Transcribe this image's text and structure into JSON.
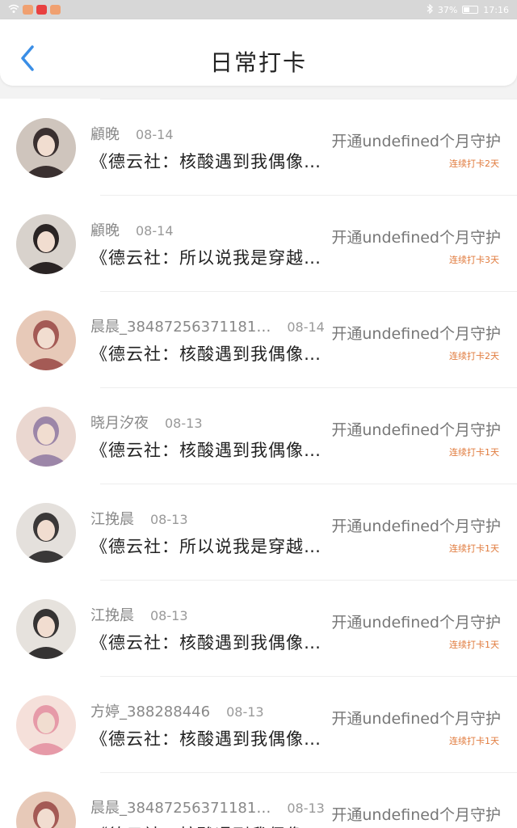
{
  "status_bar": {
    "battery": "37%",
    "time": "17:16",
    "notif_colors": [
      "#f0a070",
      "#e84040",
      "#f0a070"
    ]
  },
  "header": {
    "title": "日常打卡"
  },
  "rows": [
    {
      "name": "顧晚",
      "date": "08-14",
      "message": "《德云社：核酸遇到我偶像…",
      "guard": "开通undefined个月守护",
      "streak": "连续打卡2天",
      "avatar_colors": [
        "#3a3030",
        "#cfc5bd"
      ]
    },
    {
      "name": "顧晚",
      "date": "08-14",
      "message": "《德云社：所以说我是穿越…",
      "guard": "开通undefined个月守护",
      "streak": "连续打卡3天",
      "avatar_colors": [
        "#2a2424",
        "#d8d2cc"
      ]
    },
    {
      "name": "晨晨_38487256371181…",
      "date": "08-14",
      "message": "《德云社：核酸遇到我偶像…",
      "guard": "开通undefined个月守护",
      "streak": "连续打卡2天",
      "avatar_colors": [
        "#a45a55",
        "#e7c9b8"
      ]
    },
    {
      "name": "晓月汐夜",
      "date": "08-13",
      "message": "《德云社：核酸遇到我偶像…",
      "guard": "开通undefined个月守护",
      "streak": "连续打卡1天",
      "avatar_colors": [
        "#9c86a8",
        "#ead7d0"
      ]
    },
    {
      "name": "江挽晨",
      "date": "08-13",
      "message": "《德云社：所以说我是穿越…",
      "guard": "开通undefined个月守护",
      "streak": "连续打卡1天",
      "avatar_colors": [
        "#3a3838",
        "#e4e0dc"
      ]
    },
    {
      "name": "江挽晨",
      "date": "08-13",
      "message": "《德云社：核酸遇到我偶像…",
      "guard": "开通undefined个月守护",
      "streak": "连续打卡1天",
      "avatar_colors": [
        "#353333",
        "#e6e2dd"
      ]
    },
    {
      "name": "方婷_388288446",
      "date": "08-13",
      "message": "《德云社：核酸遇到我偶像…",
      "guard": "开通undefined个月守护",
      "streak": "连续打卡1天",
      "avatar_colors": [
        "#e69aa8",
        "#f5e0da"
      ]
    },
    {
      "name": "晨晨_38487256371181…",
      "date": "08-13",
      "message": "《德云社：核酸遇到我偶像…",
      "guard": "开通undefined个月守护",
      "streak": "",
      "avatar_colors": [
        "#a45a55",
        "#e7c9b8"
      ]
    }
  ],
  "colors": {
    "accent": "#3a8ee6",
    "streak": "#e07a3c"
  }
}
